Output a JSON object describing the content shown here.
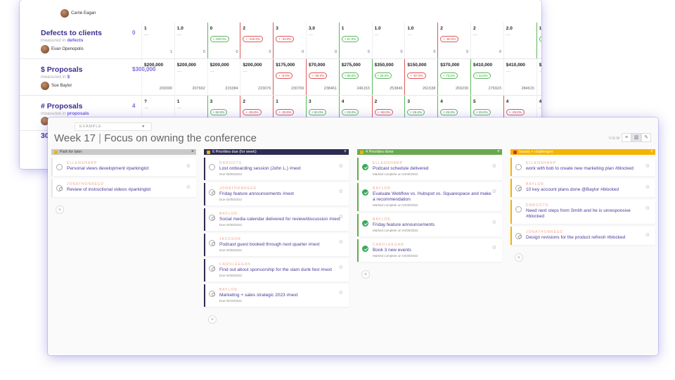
{
  "scorecard": {
    "top_owner": "Carrie Eagan",
    "rows": [
      {
        "title": "Defects to clients",
        "measured_prefix": "measured in",
        "measured_unit": "defects",
        "owner": "Evan Openopolis",
        "goal": "0",
        "cells": [
          {
            "value": "1",
            "status": "",
            "pill": "",
            "avg": "1"
          },
          {
            "value": "1.0",
            "status": "",
            "pill": "",
            "avg": "0"
          },
          {
            "value": "0",
            "status": "good",
            "pill": "+ 100.0%",
            "avg": "0"
          },
          {
            "value": "2",
            "status": "bad",
            "pill": "+ -100.0%",
            "avg": "0"
          },
          {
            "value": "3",
            "status": "bad",
            "pill": "+ -33.0%",
            "avg": "0"
          },
          {
            "value": "3.0",
            "status": "",
            "pill": "",
            "avg": "0"
          },
          {
            "value": "1",
            "status": "good",
            "pill": "+ 67.0%",
            "avg": "0"
          },
          {
            "value": "1.0",
            "status": "",
            "pill": "",
            "avg": "0"
          },
          {
            "value": "1.0",
            "status": "",
            "pill": "",
            "avg": "0"
          },
          {
            "value": "2",
            "status": "bad",
            "pill": "+ -50.0%",
            "avg": "0"
          },
          {
            "value": "2",
            "status": "",
            "pill": "",
            "avg": "0"
          },
          {
            "value": "2.0",
            "status": "",
            "pill": "",
            "avg": ""
          },
          {
            "value": "1",
            "status": "good",
            "pill": "+ 50",
            "avg": ""
          }
        ]
      },
      {
        "title": "$ Proposals",
        "measured_prefix": "measured in",
        "measured_unit": "$",
        "owner": "Sue Baylor",
        "goal": "$300,000",
        "cells": [
          {
            "value": "$200,000",
            "status": "",
            "pill": "",
            "avg": "200000"
          },
          {
            "value": "$200,000",
            "status": "",
            "pill": "",
            "avg": "207692"
          },
          {
            "value": "$200,000",
            "status": "",
            "pill": "",
            "avg": "215384"
          },
          {
            "value": "$200,000",
            "status": "",
            "pill": "",
            "avg": "223076"
          },
          {
            "value": "$175,000",
            "status": "bad",
            "pill": "+ -8.0%",
            "avg": "230769"
          },
          {
            "value": "$70,000",
            "status": "bad",
            "pill": "+ -35.0%",
            "avg": "238461"
          },
          {
            "value": "$275,000",
            "status": "good",
            "pill": "+ 68.0%",
            "avg": "246153"
          },
          {
            "value": "$350,000",
            "status": "good",
            "pill": "+ 25.0%",
            "avg": "253846"
          },
          {
            "value": "$150,000",
            "status": "bad",
            "pill": "+ -67.0%",
            "avg": "261538"
          },
          {
            "value": "$370,000",
            "status": "good",
            "pill": "+ 73.0%",
            "avg": "269230"
          },
          {
            "value": "$410,000",
            "status": "good",
            "pill": "+ 13.0%",
            "avg": "276923"
          },
          {
            "value": "$410,000",
            "status": "",
            "pill": "",
            "avg": "284615"
          },
          {
            "value": "$410",
            "status": "",
            "pill": "",
            "avg": ""
          }
        ]
      },
      {
        "title": "# Proposals",
        "measured_prefix": "measured in",
        "measured_unit": "proposals",
        "owner": "",
        "goal": "4",
        "cells": [
          {
            "value": "?",
            "status": "",
            "pill": "",
            "avg": ""
          },
          {
            "value": "1",
            "status": "",
            "pill": "",
            "avg": ""
          },
          {
            "value": "3",
            "status": "good",
            "pill": "+ 50.0%",
            "avg": ""
          },
          {
            "value": "2",
            "status": "bad",
            "pill": "+ -25.0%",
            "avg": ""
          },
          {
            "value": "1",
            "status": "bad",
            "pill": "+ -25.0%",
            "avg": ""
          },
          {
            "value": "3",
            "status": "good",
            "pill": "+ 50.0%",
            "avg": ""
          },
          {
            "value": "4",
            "status": "good",
            "pill": "+ 25.0%",
            "avg": ""
          },
          {
            "value": "2",
            "status": "bad",
            "pill": "+ -50.0%",
            "avg": ""
          },
          {
            "value": "3",
            "status": "good",
            "pill": "+ 25.0%",
            "avg": ""
          },
          {
            "value": "4",
            "status": "good",
            "pill": "+ 25.0%",
            "avg": ""
          },
          {
            "value": "5",
            "status": "good",
            "pill": "+ 25.0%",
            "avg": ""
          },
          {
            "value": "4",
            "status": "bad",
            "pill": "+ -25.0%",
            "avg": ""
          },
          {
            "value": "4.0",
            "status": "",
            "pill": "",
            "avg": ""
          }
        ]
      }
    ],
    "peek_number": "30"
  },
  "board": {
    "team_select": "EXAMPLE",
    "week_label": "Week 17",
    "separator": "|",
    "week_focus": "Focus on owning the conference",
    "view_label": "VIEW",
    "columns": [
      {
        "title": "Park for later",
        "color": "#c9c9c9",
        "head_text": "#444",
        "sq": "#f0b400",
        "plus": "×",
        "cards": [
          {
            "owner": "ELLENSHARP",
            "title": "Personal views development #parkinglot",
            "sub": "",
            "state": "open"
          },
          {
            "owner": "JONATHONREED",
            "title": "Review of instructional videos #parkinglot",
            "sub": "",
            "state": "person"
          }
        ]
      },
      {
        "title": "6 Priorities due (for week)",
        "color": "#2e2c52",
        "head_text": "#ffffff",
        "sq": "#f0b400",
        "plus": "+",
        "cards": [
          {
            "owner": "DRROOTS",
            "title": "Lost onboarding session (John L.) #next",
            "sub": "Due 05/05/2022",
            "state": "open"
          },
          {
            "owner": "JONATHONREED",
            "title": "Friday feature announcements #next",
            "sub": "Due 04/05/2022",
            "state": "person"
          },
          {
            "owner": "BAYLOR",
            "title": "Social media calendar delivered for review/discussion #next",
            "sub": "Due 04/05/2022",
            "state": "person"
          },
          {
            "owner": "JACKSON",
            "title": "Podcast guest booked through next quarter #next",
            "sub": "Due 04/05/2022",
            "state": "person"
          },
          {
            "owner": "CAROLEEGAN",
            "title": "Find out about sponsorship for the slam dunk fest #next",
            "sub": "Due 04/05/2022",
            "state": "person"
          },
          {
            "owner": "BAYLOR",
            "title": "Marketing + sales strategic 2023 #next",
            "sub": "Due 04/15/2022",
            "state": "person"
          }
        ]
      },
      {
        "title": "4 Priorities done",
        "color": "#6aa84f",
        "head_text": "#ffffff",
        "sq": "#f0b400",
        "plus": "+",
        "cards": [
          {
            "owner": "ELLENSHARP",
            "title": "Podcast schedule delivered",
            "sub": "Marked complete on 04/30/2022",
            "state": "done"
          },
          {
            "owner": "BAYLOR",
            "title": "Evaluate Webflow vs. Hubspot vs. Squarespace and make a recommendation",
            "sub": "Marked complete on 04/30/2022",
            "state": "done"
          },
          {
            "owner": "BAYLOR",
            "title": "Friday feature announcements",
            "sub": "Marked complete on 04/30/2022",
            "state": "done"
          },
          {
            "owner": "CAROLEEGAN",
            "title": "Book 3 new events",
            "sub": "Marked complete on 04/30/2022",
            "state": "done"
          }
        ]
      },
      {
        "title": "Issues + challenges",
        "color": "#f4b400",
        "head_text": "#ffffff",
        "sq": "#d93025",
        "plus": "+",
        "cards": [
          {
            "owner": "ELLENSHARP",
            "title": "work with bob to create new marketing plan #blocked",
            "sub": "",
            "state": "open"
          },
          {
            "owner": "BAYLOR",
            "title": "10 key account plans done @Baylor #blocked",
            "sub": "",
            "state": "person"
          },
          {
            "owner": "DRROOTS",
            "title": "Need next steps from Smith and he is unresponsive #blocked",
            "sub": "",
            "state": "open"
          },
          {
            "owner": "JONATHONREED",
            "title": "Design revisions for the product refresh #blocked",
            "sub": "",
            "state": "person"
          }
        ]
      }
    ],
    "add_label": "+"
  }
}
